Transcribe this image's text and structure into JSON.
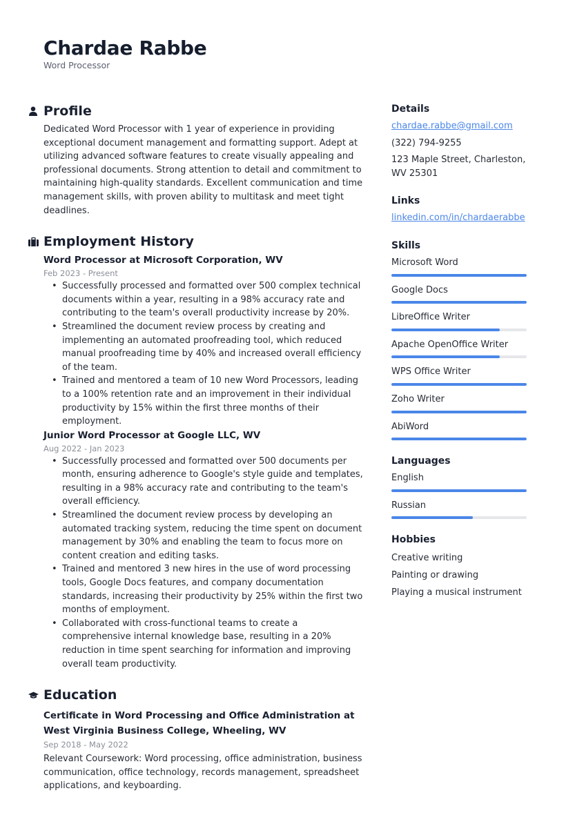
{
  "header": {
    "name": "Chardae Rabbe",
    "title": "Word Processor"
  },
  "profile": {
    "heading": "Profile",
    "icon": "person-icon",
    "text": "Dedicated Word Processor with 1 year of experience in providing exceptional document management and formatting support. Adept at utilizing advanced software features to create visually appealing and professional documents. Strong attention to detail and commitment to maintaining high-quality standards. Excellent communication and time management skills, with proven ability to multitask and meet tight deadlines."
  },
  "employment": {
    "heading": "Employment History",
    "icon": "briefcase-icon",
    "jobs": [
      {
        "title": "Word Processor at Microsoft Corporation, WV",
        "dates": "Feb 2023 - Present",
        "bullets": [
          "Successfully processed and formatted over 500 complex technical documents within a year, resulting in a 98% accuracy rate and contributing to the team's overall productivity increase by 20%.",
          "Streamlined the document review process by creating and implementing an automated proofreading tool, which reduced manual proofreading time by 40% and increased overall efficiency of the team.",
          "Trained and mentored a team of 10 new Word Processors, leading to a 100% retention rate and an improvement in their individual productivity by 15% within the first three months of their employment."
        ]
      },
      {
        "title": "Junior Word Processor at Google LLC, WV",
        "dates": "Aug 2022 - Jan 2023",
        "bullets": [
          "Successfully processed and formatted over 500 documents per month, ensuring adherence to Google's style guide and templates, resulting in a 98% accuracy rate and contributing to the team's overall efficiency.",
          "Streamlined the document review process by developing an automated tracking system, reducing the time spent on document management by 30% and enabling the team to focus more on content creation and editing tasks.",
          "Trained and mentored 3 new hires in the use of word processing tools, Google Docs features, and company documentation standards, increasing their productivity by 25% within the first two months of employment.",
          "Collaborated with cross-functional teams to create a comprehensive internal knowledge base, resulting in a 20% reduction in time spent searching for information and improving overall team productivity."
        ]
      }
    ]
  },
  "education": {
    "heading": "Education",
    "icon": "graduation-cap-icon",
    "entries": [
      {
        "title": "Certificate in Word Processing and Office Administration at West Virginia Business College, Wheeling, WV",
        "dates": "Sep 2018 - May 2022",
        "text": "Relevant Coursework: Word processing, office administration, business communication, office technology, records management, spreadsheet applications, and keyboarding."
      }
    ]
  },
  "details": {
    "heading": "Details",
    "email": "chardae.rabbe@gmail.com",
    "phone": "(322) 794-9255",
    "address": "123 Maple Street, Charleston, WV 25301"
  },
  "links": {
    "heading": "Links",
    "items": [
      "linkedin.com/in/chardaerabbe"
    ]
  },
  "skills": {
    "heading": "Skills",
    "items": [
      {
        "name": "Microsoft Word",
        "level": 100
      },
      {
        "name": "Google Docs",
        "level": 100
      },
      {
        "name": "LibreOffice Writer",
        "level": 80
      },
      {
        "name": "Apache OpenOffice Writer",
        "level": 80
      },
      {
        "name": "WPS Office Writer",
        "level": 100
      },
      {
        "name": "Zoho Writer",
        "level": 100
      },
      {
        "name": "AbiWord",
        "level": 100
      }
    ]
  },
  "languages": {
    "heading": "Languages",
    "items": [
      {
        "name": "English",
        "level": 100
      },
      {
        "name": "Russian",
        "level": 60
      }
    ]
  },
  "hobbies": {
    "heading": "Hobbies",
    "items": [
      "Creative writing",
      "Painting or drawing",
      "Playing a musical instrument"
    ]
  },
  "colors": {
    "accent": "#4a86e8",
    "bar_track": "#e6e7ea",
    "text": "#262b35",
    "muted": "#8a8f99"
  }
}
